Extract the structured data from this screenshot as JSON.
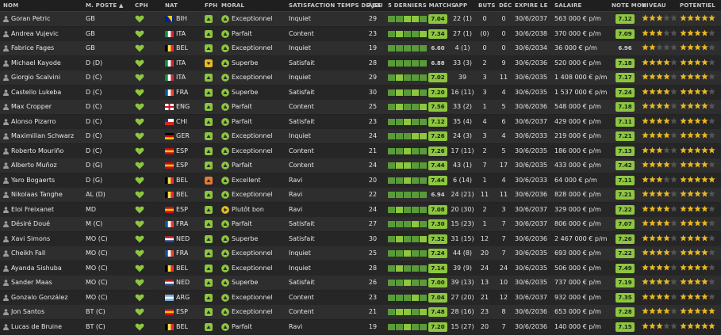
{
  "headers": {
    "nom": "NOM",
    "poste": "M. POSTE",
    "cph": "CPH",
    "nat": "NAT",
    "fph": "FPH",
    "moral": "MORAL",
    "satisf": "SATISFACTION TEMPS DE JEU",
    "age": "ÂGE",
    "form": "5 DERNIERS MATCHS",
    "app": "APP",
    "buts": "BUTS",
    "dec": "DÉC",
    "expire": "EXPIRE LE",
    "salaire": "SALAIRE",
    "note": "NOTE MOY",
    "niveau": "NIVEAU",
    "potentiel": "POTENTIEL"
  },
  "colors": {
    "green": "#8dc63f",
    "yellow": "#e8b923",
    "orange": "#e07b39",
    "star": "#e8b923",
    "star_empty": "#555555"
  },
  "players": [
    {
      "name": "Goran Petric",
      "pos": "GB",
      "nat": "BIH",
      "moral": "Exceptionnel",
      "moral_icon": "up-arrow-icon",
      "satisf": "Inquiet",
      "age": "29",
      "form": [
        "#5a9a3a",
        "#5a9a3a",
        "#8dc63f",
        "#8dc63f",
        "#5a9a3a"
      ],
      "form_rating": "7.04",
      "app": "22 (1)",
      "buts": "0",
      "dec": "0",
      "expire": "30/6/2037",
      "salaire": "563 000 € p/m",
      "note": "7.12",
      "niveau": 3,
      "potentiel": 5
    },
    {
      "name": "Andrea Vujevic",
      "pos": "GB",
      "nat": "ITA",
      "moral": "Parfait",
      "moral_icon": "up-arrow-icon",
      "satisf": "Content",
      "age": "23",
      "form": [
        "#5a9a3a",
        "#8dc63f",
        "#5a9a3a",
        "#5a9a3a",
        "#8dc63f"
      ],
      "form_rating": "7.34",
      "app": "27 (1)",
      "buts": "(0)",
      "dec": "0",
      "expire": "30/6/2038",
      "salaire": "370 000 € p/m",
      "note": "7.09",
      "niveau": 3,
      "potentiel": 4
    },
    {
      "name": "Fabrice Fages",
      "pos": "GB",
      "nat": "BEL",
      "moral": "Exceptionnel",
      "moral_icon": "up-arrow-icon",
      "satisf": "Inquiet",
      "age": "19",
      "form": [
        "#5a9a3a",
        "#5a9a3a",
        "#5a9a3a",
        "#5a9a3a",
        "#5a9a3a"
      ],
      "form_rating": "6.60",
      "app": "4 (1)",
      "buts": "0",
      "dec": "0",
      "expire": "30/6/2034",
      "salaire": "36 000 € p/m",
      "note": "6.96",
      "niveau": 2,
      "potentiel": 4
    },
    {
      "name": "Michael Kayode",
      "pos": "D (D)",
      "nat": "ITA",
      "moral": "Superbe",
      "moral_icon": "up-arrow-icon",
      "satisf": "Satisfait",
      "age": "28",
      "form": [
        "#5a9a3a",
        "#5a9a3a",
        "#5a9a3a",
        "#5a9a3a",
        "#5a9a3a"
      ],
      "form_rating": "6.88",
      "app": "33 (3)",
      "buts": "2",
      "dec": "9",
      "expire": "30/6/2036",
      "salaire": "520 000 € p/m",
      "note": "7.18",
      "niveau": 4,
      "potentiel": 4
    },
    {
      "name": "Giorgio Scalvini",
      "pos": "D (C)",
      "nat": "ITA",
      "moral": "Exceptionnel",
      "moral_icon": "up-arrow-icon",
      "satisf": "Inquiet",
      "age": "29",
      "form": [
        "#5a9a3a",
        "#8dc63f",
        "#5a9a3a",
        "#5a9a3a",
        "#5a9a3a"
      ],
      "form_rating": "7.02",
      "app": "39",
      "buts": "3",
      "dec": "11",
      "expire": "30/6/2035",
      "salaire": "1 408 000 € p/m",
      "note": "7.17",
      "niveau": 4,
      "potentiel": 4
    },
    {
      "name": "Castello Lukeba",
      "pos": "D (C)",
      "nat": "FRA",
      "moral": "Superbe",
      "moral_icon": "up-arrow-icon",
      "satisf": "Satisfait",
      "age": "30",
      "form": [
        "#5a9a3a",
        "#8dc63f",
        "#5a9a3a",
        "#8dc63f",
        "#5a9a3a"
      ],
      "form_rating": "7.20",
      "app": "16 (11)",
      "buts": "3",
      "dec": "4",
      "expire": "30/6/2035",
      "salaire": "1 537 000 € p/m",
      "note": "7.24",
      "niveau": 4,
      "potentiel": 4
    },
    {
      "name": "Max Cropper",
      "pos": "D (C)",
      "nat": "ENG",
      "moral": "Parfait",
      "moral_icon": "up-arrow-icon",
      "satisf": "Content",
      "age": "25",
      "form": [
        "#5a9a3a",
        "#8dc63f",
        "#5a9a3a",
        "#5a9a3a",
        "#8dc63f"
      ],
      "form_rating": "7.56",
      "app": "33 (2)",
      "buts": "1",
      "dec": "5",
      "expire": "30/6/2036",
      "salaire": "548 000 € p/m",
      "note": "7.18",
      "niveau": 4,
      "potentiel": 4
    },
    {
      "name": "Alonso Pizarro",
      "pos": "D (C)",
      "nat": "CHI",
      "moral": "Parfait",
      "moral_icon": "up-arrow-icon",
      "satisf": "Satisfait",
      "age": "23",
      "form": [
        "#5a9a3a",
        "#5a9a3a",
        "#8dc63f",
        "#5a9a3a",
        "#5a9a3a"
      ],
      "form_rating": "7.12",
      "app": "35 (4)",
      "buts": "4",
      "dec": "6",
      "expire": "30/6/2037",
      "salaire": "429 000 € p/m",
      "note": "7.11",
      "niveau": 4,
      "potentiel": 4
    },
    {
      "name": "Maximilian Schwarz",
      "pos": "D (C)",
      "nat": "GER",
      "moral": "Exceptionnel",
      "moral_icon": "up-arrow-icon",
      "satisf": "Inquiet",
      "age": "24",
      "form": [
        "#5a9a3a",
        "#5a9a3a",
        "#5a9a3a",
        "#8dc63f",
        "#8dc63f"
      ],
      "form_rating": "7.26",
      "app": "24 (3)",
      "buts": "3",
      "dec": "4",
      "expire": "30/6/2033",
      "salaire": "219 000 € p/m",
      "note": "7.21",
      "niveau": 4,
      "potentiel": 4
    },
    {
      "name": "Roberto Mouriño",
      "pos": "D (C)",
      "nat": "ESP",
      "moral": "Exceptionnel",
      "moral_icon": "up-arrow-icon",
      "satisf": "Content",
      "age": "21",
      "form": [
        "#5a9a3a",
        "#5a9a3a",
        "#8dc63f",
        "#5a9a3a",
        "#5a9a3a"
      ],
      "form_rating": "7.26",
      "app": "17 (11)",
      "buts": "2",
      "dec": "5",
      "expire": "30/6/2035",
      "salaire": "186 000 € p/m",
      "note": "7.13",
      "niveau": 3,
      "potentiel": 5
    },
    {
      "name": "Alberto Muñoz",
      "pos": "D (G)",
      "nat": "ESP",
      "moral": "Parfait",
      "moral_icon": "up-arrow-icon",
      "satisf": "Content",
      "age": "24",
      "form": [
        "#5a9a3a",
        "#8dc63f",
        "#8dc63f",
        "#5a9a3a",
        "#5a9a3a"
      ],
      "form_rating": "7.44",
      "app": "43 (1)",
      "buts": "7",
      "dec": "17",
      "expire": "30/6/2035",
      "salaire": "433 000 € p/m",
      "note": "7.42",
      "niveau": 4,
      "potentiel": 4
    },
    {
      "name": "Yaro Bogaerts",
      "pos": "D (G)",
      "nat": "BEL",
      "moral": "Excellent",
      "moral_icon": "up-arrow-icon",
      "satisf": "Ravi",
      "age": "20",
      "form": [
        "#5a9a3a",
        "#5a9a3a",
        "#8dc63f",
        "#5a9a3a",
        "#5a9a3a"
      ],
      "form_rating": "7.44",
      "app": "6 (14)",
      "buts": "1",
      "dec": "4",
      "expire": "30/6/2033",
      "salaire": "64 000 € p/m",
      "note": "7.11",
      "niveau": 3,
      "potentiel": 5
    },
    {
      "name": "Nikolaas Tanghe",
      "pos": "AL (D)",
      "nat": "BEL",
      "moral": "Exceptionnel",
      "moral_icon": "up-arrow-icon",
      "satisf": "Ravi",
      "age": "22",
      "form": [
        "#5a9a3a",
        "#5a9a3a",
        "#5a9a3a",
        "#5a9a3a",
        "#5a9a3a"
      ],
      "form_rating": "6.94",
      "app": "24 (21)",
      "buts": "11",
      "dec": "11",
      "expire": "30/6/2036",
      "salaire": "828 000 € p/m",
      "note": "7.21",
      "niveau": 4,
      "potentiel": 4
    },
    {
      "name": "Eloi Freixanet",
      "pos": "MD",
      "nat": "ESP",
      "moral": "Plutôt bon",
      "moral_icon": "right-arrow-icon",
      "satisf": "Ravi",
      "age": "24",
      "form": [
        "#5a9a3a",
        "#8dc63f",
        "#5a9a3a",
        "#5a9a3a",
        "#5a9a3a"
      ],
      "form_rating": "7.08",
      "app": "20 (30)",
      "buts": "2",
      "dec": "3",
      "expire": "30/6/2037",
      "salaire": "329 000 € p/m",
      "note": "7.22",
      "niveau": 4,
      "potentiel": 4
    },
    {
      "name": "Désiré Doué",
      "pos": "M (C)",
      "nat": "FRA",
      "moral": "Parfait",
      "moral_icon": "up-arrow-icon",
      "satisf": "Satisfait",
      "age": "27",
      "form": [
        "#5a9a3a",
        "#5a9a3a",
        "#5a9a3a",
        "#8dc63f",
        "#5a9a3a"
      ],
      "form_rating": "7.30",
      "app": "15 (23)",
      "buts": "1",
      "dec": "7",
      "expire": "30/6/2037",
      "salaire": "806 000 € p/m",
      "note": "7.07",
      "niveau": 4,
      "potentiel": 4
    },
    {
      "name": "Xavi Simons",
      "pos": "MO (C)",
      "nat": "NED",
      "moral": "Superbe",
      "moral_icon": "up-arrow-icon",
      "satisf": "Satisfait",
      "age": "30",
      "form": [
        "#5a9a3a",
        "#8dc63f",
        "#5a9a3a",
        "#5a9a3a",
        "#8dc63f"
      ],
      "form_rating": "7.32",
      "app": "31 (15)",
      "buts": "12",
      "dec": "7",
      "expire": "30/6/2036",
      "salaire": "2 467 000 € p/m",
      "note": "7.26",
      "niveau": 4,
      "potentiel": 4
    },
    {
      "name": "Cheikh Fall",
      "pos": "MO (C)",
      "nat": "FRA",
      "moral": "Exceptionnel",
      "moral_icon": "up-arrow-icon",
      "satisf": "Inquiet",
      "age": "25",
      "form": [
        "#5a9a3a",
        "#5a9a3a",
        "#8dc63f",
        "#5a9a3a",
        "#5a9a3a"
      ],
      "form_rating": "7.24",
      "app": "44 (8)",
      "buts": "20",
      "dec": "7",
      "expire": "30/6/2035",
      "salaire": "693 000 € p/m",
      "note": "7.22",
      "niveau": 4,
      "potentiel": 4
    },
    {
      "name": "Ayanda Sishuba",
      "pos": "MO (C)",
      "nat": "BEL",
      "moral": "Exceptionnel",
      "moral_icon": "up-arrow-icon",
      "satisf": "Inquiet",
      "age": "28",
      "form": [
        "#5a9a3a",
        "#8dc63f",
        "#5a9a3a",
        "#5a9a3a",
        "#5a9a3a"
      ],
      "form_rating": "7.14",
      "app": "39 (9)",
      "buts": "24",
      "dec": "24",
      "expire": "30/6/2035",
      "salaire": "506 000 € p/m",
      "note": "7.49",
      "niveau": 4,
      "potentiel": 4
    },
    {
      "name": "Sander Maas",
      "pos": "MO (C)",
      "nat": "NED",
      "moral": "Superbe",
      "moral_icon": "up-arrow-icon",
      "satisf": "Satisfait",
      "age": "26",
      "form": [
        "#5a9a3a",
        "#5a9a3a",
        "#8dc63f",
        "#5a9a3a",
        "#5a9a3a"
      ],
      "form_rating": "7.00",
      "app": "39 (13)",
      "buts": "13",
      "dec": "10",
      "expire": "30/6/2035",
      "salaire": "737 000 € p/m",
      "note": "7.19",
      "niveau": 4,
      "potentiel": 4
    },
    {
      "name": "Gonzalo González",
      "pos": "MO (C)",
      "nat": "ARG",
      "moral": "Exceptionnel",
      "moral_icon": "up-arrow-icon",
      "satisf": "Content",
      "age": "23",
      "form": [
        "#5a9a3a",
        "#5a9a3a",
        "#5a9a3a",
        "#8dc63f",
        "#5a9a3a"
      ],
      "form_rating": "7.04",
      "app": "27 (20)",
      "buts": "21",
      "dec": "12",
      "expire": "30/6/2037",
      "salaire": "932 000 € p/m",
      "note": "7.35",
      "niveau": 4,
      "potentiel": 4
    },
    {
      "name": "Jon Santos",
      "pos": "BT (C)",
      "nat": "ESP",
      "moral": "Exceptionnel",
      "moral_icon": "up-arrow-icon",
      "satisf": "Content",
      "age": "21",
      "form": [
        "#5a9a3a",
        "#8dc63f",
        "#8dc63f",
        "#5a9a3a",
        "#8dc63f"
      ],
      "form_rating": "7.48",
      "app": "28 (16)",
      "buts": "23",
      "dec": "8",
      "expire": "30/6/2036",
      "salaire": "653 000 € p/m",
      "note": "7.28",
      "niveau": 4,
      "potentiel": 5
    },
    {
      "name": "Lucas de Bruine",
      "pos": "BT (C)",
      "nat": "BEL",
      "moral": "Parfait",
      "moral_icon": "up-arrow-icon",
      "satisf": "Ravi",
      "age": "19",
      "form": [
        "#5a9a3a",
        "#5a9a3a",
        "#8dc63f",
        "#5a9a3a",
        "#5a9a3a"
      ],
      "form_rating": "7.20",
      "app": "15 (27)",
      "buts": "20",
      "dec": "7",
      "expire": "30/6/2036",
      "salaire": "140 000 € p/m",
      "note": "7.15",
      "niveau": 3,
      "potentiel": 5
    }
  ]
}
